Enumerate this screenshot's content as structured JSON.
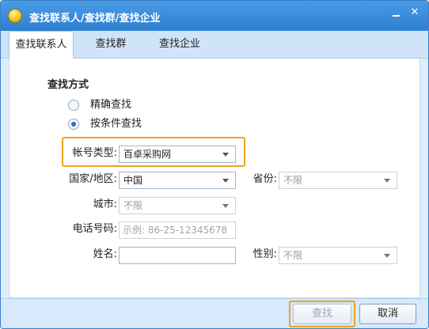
{
  "window": {
    "title": "查找联系人/查找群/查找企业",
    "minimize_glyph": "",
    "close_glyph": "✕"
  },
  "tabs": [
    {
      "label": "查找联系人",
      "active": true
    },
    {
      "label": "查找群",
      "active": false
    },
    {
      "label": "查找企业",
      "active": false
    }
  ],
  "search_method": {
    "title": "查找方式",
    "options": [
      {
        "label": "精确查找",
        "selected": false
      },
      {
        "label": "按条件查找",
        "selected": true
      }
    ]
  },
  "form": {
    "account_type": {
      "label": "帐号类型:",
      "value": "百卓采购网"
    },
    "country": {
      "label": "国家/地区:",
      "value": "中国"
    },
    "province": {
      "label": "省份:",
      "value": "不限"
    },
    "city": {
      "label": "城市:",
      "value": "不限"
    },
    "phone": {
      "label": "电话号码:",
      "placeholder": "示例: 86-25-12345678"
    },
    "name": {
      "label": "姓名:",
      "value": ""
    },
    "gender": {
      "label": "性别:",
      "value": "不限"
    }
  },
  "buttons": {
    "search": "查找",
    "cancel": "取消"
  },
  "colors": {
    "title_bar": "#2d7fd0",
    "highlight": "#f0a21e",
    "footer": "#d7e9fb"
  }
}
